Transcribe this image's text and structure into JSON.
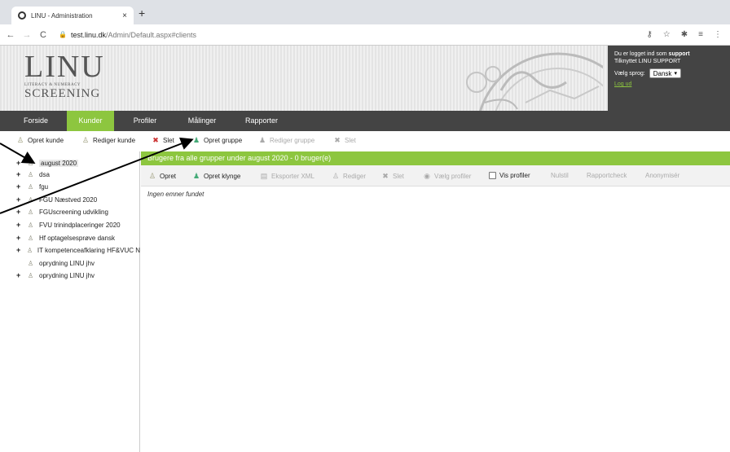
{
  "browser": {
    "tab_title": "LINU - Administration",
    "tab_close": "×",
    "new_tab": "+",
    "url_host": "test.linu.dk",
    "url_path": "/Admin/Default.aspx#clients"
  },
  "header": {
    "logo_main": "LINU",
    "logo_sub": "LITERACY & NUMERACY",
    "logo_bottom": "SCREENING",
    "logged_in_prefix": "Du er logget ind som",
    "logged_in_user": "support",
    "affiliation": "Tilknyttet LINU SUPPORT",
    "language_label": "Vælg sprog:",
    "language_value": "Dansk",
    "logout": "Log ud"
  },
  "nav": {
    "items": [
      {
        "label": "Forside"
      },
      {
        "label": "Kunder"
      },
      {
        "label": "Profiler"
      },
      {
        "label": "Målinger"
      },
      {
        "label": "Rapporter"
      }
    ],
    "active": "Kunder"
  },
  "toolbar": {
    "create_customer": "Opret kunde",
    "edit_customer": "Rediger kunde",
    "delete": "Slet",
    "create_group": "Opret gruppe",
    "edit_group": "Rediger gruppe",
    "delete2": "Slet"
  },
  "tree": {
    "items": [
      {
        "label": "august 2020",
        "expandable": true,
        "selected": true
      },
      {
        "label": "dsa",
        "expandable": true
      },
      {
        "label": "fgu",
        "expandable": true
      },
      {
        "label": "FGU Næstved 2020",
        "expandable": true
      },
      {
        "label": "FGUscreening udvikling",
        "expandable": true
      },
      {
        "label": "FVU trinindplaceringer 2020",
        "expandable": true
      },
      {
        "label": "Hf optagelsesprøve dansk",
        "expandable": true
      },
      {
        "label": "IT kompetenceafklaring HF&VUC N",
        "expandable": true
      },
      {
        "label": "oprydning LINU jhv",
        "expandable": false
      },
      {
        "label": "oprydning LINU jhv",
        "expandable": true
      }
    ]
  },
  "main": {
    "header": "Brugere fra alle grupper under august 2020 - 0 bruger(e)",
    "actions": {
      "create": "Opret",
      "create_cluster": "Opret klynge",
      "export_xml": "Eksporter XML",
      "edit": "Rediger",
      "delete": "Slet",
      "choose_profiles": "Vælg profiler",
      "show_profiles": "Vis profiler",
      "reset": "Nulstil",
      "report_check": "Rapportcheck",
      "anonymize": "Anonymisér"
    },
    "empty_message": "Ingen emner fundet"
  },
  "colors": {
    "accent_green": "#8dc63f",
    "dark_nav": "#444444"
  }
}
